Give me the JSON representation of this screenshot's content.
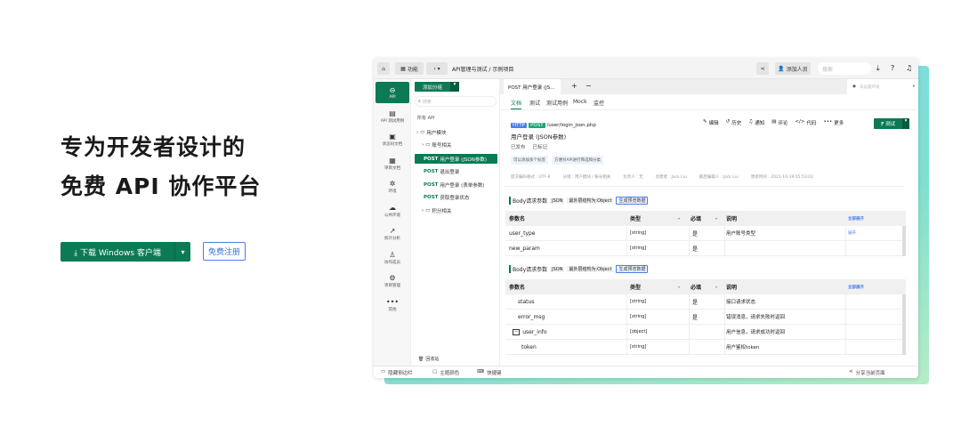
{
  "hero": {
    "line1": "专为开发者设计的",
    "line2": "免费 API 协作平台",
    "download_label": "下载 Windows 客户端",
    "register_label": "免费注册"
  },
  "topbar": {
    "features": "功能",
    "breadcrumb": "API管理与测试  /  示例项目",
    "add_member": "添加人员",
    "search_placeholder": "搜索"
  },
  "rail": [
    {
      "label": "API",
      "icon": "link-icon"
    },
    {
      "label": "API 测试用例",
      "icon": "clipboard-icon"
    },
    {
      "label": "状态码文档",
      "icon": "doc-icon"
    },
    {
      "label": "项目文档",
      "icon": "book-icon"
    },
    {
      "label": "环境",
      "icon": "env-icon"
    },
    {
      "label": "公共环境",
      "icon": "cloud-icon"
    },
    {
      "label": "统计分析",
      "icon": "chart-icon"
    },
    {
      "label": "协作成员",
      "icon": "user-icon"
    },
    {
      "label": "项目管理",
      "icon": "settings-icon"
    },
    {
      "label": "其他",
      "icon": "more-icon"
    }
  ],
  "tree": {
    "add_group": "添加分组",
    "search_placeholder": "搜索",
    "all_api": "所有 API",
    "items": [
      {
        "label": "用户模块",
        "type": "folder"
      },
      {
        "label": "账号相关",
        "type": "folder"
      },
      {
        "method": "POST",
        "label": "用户登录 (JSON参数)",
        "active": true
      },
      {
        "method": "POST",
        "label": "退出登录"
      },
      {
        "method": "POST",
        "label": "用户登录 (表单参数)"
      },
      {
        "method": "POST",
        "label": "获取登录状态"
      },
      {
        "label": "积分相关",
        "type": "folder"
      }
    ],
    "recycle": "回收站"
  },
  "tabs": {
    "open_tab": "POST 用户登录 (JS...",
    "env": "未设置环境",
    "subtabs": [
      "文档",
      "测试",
      "测试用例",
      "Mock",
      "监控"
    ]
  },
  "api": {
    "protocol": "HTTP",
    "method": "POST",
    "path": "/user/login_json.php",
    "title": "用户登录 (JSON参数)",
    "status1": "已发布",
    "status2": "已标记",
    "tags": [
      "可以添加多个标签",
      "方便对API进行筛选和分类"
    ],
    "meta": [
      "提交编码格式 : UTF-8",
      "分组 : 用户模块 / 账号相关",
      "负责人 : 无",
      "创建者 : Jack Liu",
      "最后编辑人 : Jack Liu",
      "更新时间 : 2021-10-19 05:53:02"
    ],
    "actions": [
      "编辑",
      "历史",
      "通知",
      "评论",
      "代码",
      "更多"
    ],
    "test": "测试"
  },
  "body_req": {
    "label": "Body请求参数",
    "format": "JSON",
    "outer": "最外层结构为:Object",
    "gen": "生成预览数据",
    "expand_all": "全部展开",
    "headers": [
      "参数名",
      "类型",
      "必填",
      "说明"
    ],
    "rows": [
      {
        "name": "user_type",
        "type": "[string]",
        "req": "是",
        "desc": "用户账号类型",
        "action": "展开"
      },
      {
        "name": "new_param",
        "type": "[string]",
        "req": "是",
        "desc": ""
      }
    ]
  },
  "body_res": {
    "label": "Body请求参数",
    "format": "JSON",
    "outer": "最外层结构为:Object",
    "gen": "生成预览数据",
    "expand_all": "全部展开",
    "headers": [
      "参数名",
      "类型",
      "必填",
      "说明"
    ],
    "rows": [
      {
        "name": "status",
        "type": "[string]",
        "req": "是",
        "desc": "接口请求状态"
      },
      {
        "name": "error_msg",
        "type": "[string]",
        "req": "是",
        "desc": "错误消息，请求失败时返回"
      },
      {
        "name": "user_info",
        "type": "[object]",
        "req": "",
        "desc": "用户信息，请求成功时返回"
      },
      {
        "name": "token",
        "type": "[string]",
        "req": "",
        "desc": "用户鉴权token"
      }
    ]
  },
  "bottom": {
    "hide_sidebar": "隐藏侧边栏",
    "theme": "主题颜色",
    "shortcuts": "快捷键",
    "share": "分享当前页面"
  },
  "colors": {
    "brand": "#0b7a55",
    "link": "#4a7ee8"
  }
}
